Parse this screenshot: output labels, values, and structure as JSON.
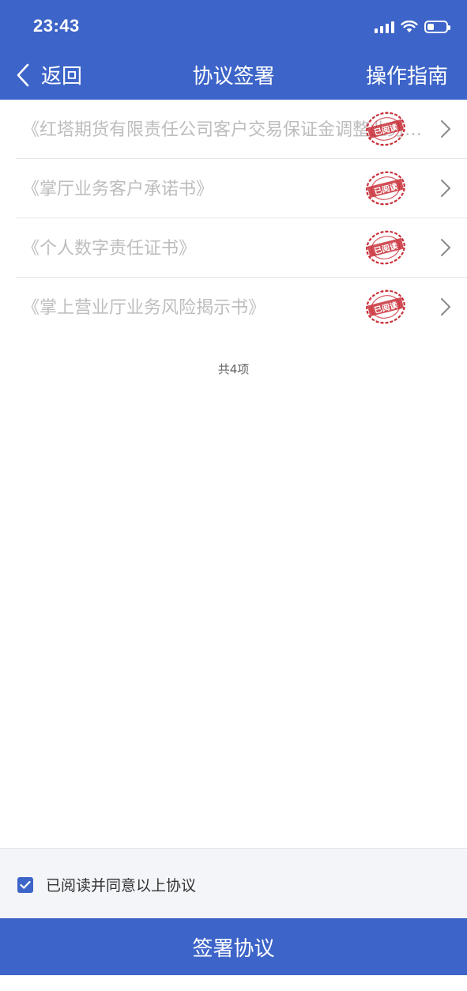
{
  "status_bar": {
    "time": "23:43"
  },
  "nav": {
    "back_label": "返回",
    "title": "协议签署",
    "guide_label": "操作指南"
  },
  "agreements": [
    {
      "title": "《红塔期货有限责任公司客户交易保证金调整业务协议》",
      "stamp_text": "已阅读"
    },
    {
      "title": "《掌厅业务客户承诺书》",
      "stamp_text": "已阅读"
    },
    {
      "title": "《个人数字责任证书》",
      "stamp_text": "已阅读"
    },
    {
      "title": "《掌上营业厅业务风险揭示书》",
      "stamp_text": "已阅读"
    }
  ],
  "count_label": "共4项",
  "agreement_checkbox": {
    "label": "已阅读并同意以上协议",
    "checked": true
  },
  "sign_button_label": "签署协议",
  "colors": {
    "primary": "#3d64c8",
    "stamp_red": "#c9303a",
    "muted_text": "#bdbdbd"
  }
}
